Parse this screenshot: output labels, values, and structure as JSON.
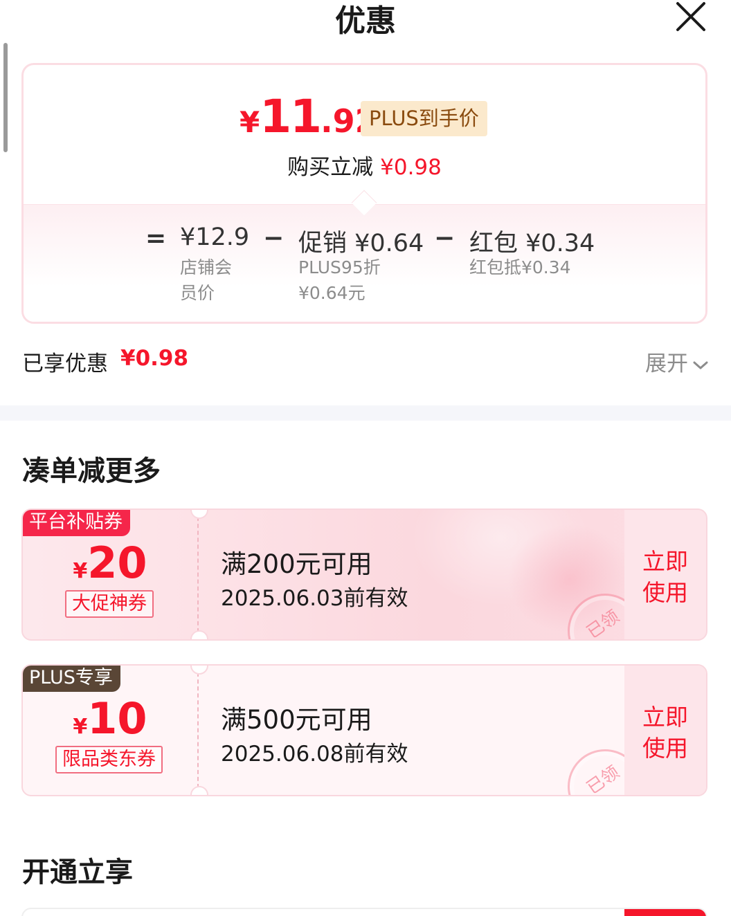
{
  "header": {
    "title": "优惠"
  },
  "price_card": {
    "currency": "¥",
    "final_int": "11",
    "final_dec": ".92",
    "plus_badge": "PLUS到手价",
    "reduce_label": "购买立减",
    "reduce_amount": "¥0.98",
    "breakdown": {
      "eq": "=",
      "minus": "−",
      "base_amount": "¥12.9",
      "base_desc": "店铺会员价",
      "promo_amount": "促销 ¥0.64",
      "promo_desc": "PLUS95折¥0.64元",
      "redpacket_amount": "红包 ¥0.34",
      "redpacket_desc": "红包抵¥0.34"
    }
  },
  "enjoyed": {
    "label": "已享优惠",
    "amount": "¥0.98",
    "expand": "展开"
  },
  "sections": {
    "more": "凑单减更多",
    "open": "开通立享"
  },
  "coupons": [
    {
      "tag": "平台补贴券",
      "currency": "¥",
      "value": "20",
      "label": "大促神券",
      "condition": "满200元可用",
      "valid": "2025.06.03前有效",
      "action": "立即使用",
      "stamp": "已领"
    },
    {
      "tag": "PLUS专享",
      "currency": "¥",
      "value": "10",
      "label": "限品类东券",
      "condition": "满500元可用",
      "valid": "2025.06.08前有效",
      "action": "立即使用",
      "stamp": "已领"
    }
  ],
  "colors": {
    "accent": "#f5162b",
    "plus_gold": "#8a4b0f",
    "plus_dark": "#5a4636"
  }
}
